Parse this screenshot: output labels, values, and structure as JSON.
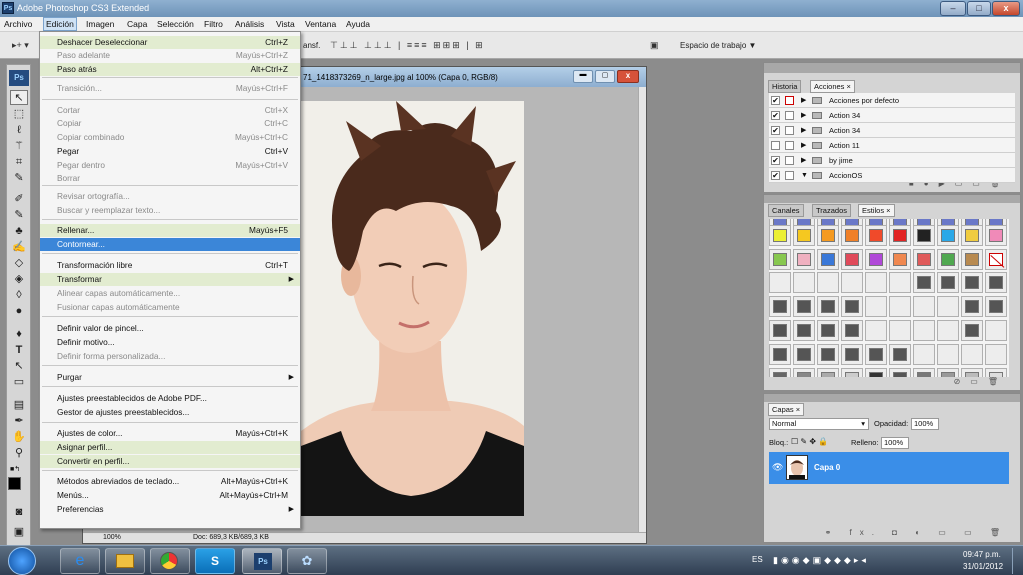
{
  "title_bar": {
    "app_icon": "Ps",
    "title": "Adobe Photoshop CS3 Extended",
    "minimize": "–",
    "maximize": "□",
    "close": "x"
  },
  "menubar": [
    "Archivo",
    "Edición",
    "Imagen",
    "Capa",
    "Selección",
    "Filtro",
    "Análisis",
    "Vista",
    "Ventana",
    "Ayuda"
  ],
  "options_bar": {
    "transform_label": "ansf.",
    "workspace_label": "Espacio de trabajo ▼"
  },
  "document": {
    "title": "71_1418373269_n_large.jpg al 100% (Capa 0, RGB/8)",
    "zoom": "100%",
    "doc_size": "Doc: 689,3 KB/689,3 KB"
  },
  "edit_menu": [
    {
      "label": "Deshacer Deseleccionar",
      "shortcut": "Ctrl+Z",
      "state": "hl"
    },
    {
      "label": "Paso adelante",
      "shortcut": "Mayús+Ctrl+Z",
      "state": "dis"
    },
    {
      "label": "Paso atrás",
      "shortcut": "Alt+Ctrl+Z",
      "state": "hl"
    },
    {
      "label": "Transición...",
      "shortcut": "Mayús+Ctrl+F",
      "state": "dis"
    },
    {
      "label": "Cortar",
      "shortcut": "Ctrl+X",
      "state": "dis"
    },
    {
      "label": "Copiar",
      "shortcut": "Ctrl+C",
      "state": "dis"
    },
    {
      "label": "Copiar combinado",
      "shortcut": "Mayús+Ctrl+C",
      "state": "dis"
    },
    {
      "label": "Pegar",
      "shortcut": "Ctrl+V",
      "state": "norm"
    },
    {
      "label": "Pegar dentro",
      "shortcut": "Mayús+Ctrl+V",
      "state": "dis"
    },
    {
      "label": "Borrar",
      "shortcut": "",
      "state": "dis"
    },
    {
      "label": "Revisar ortografía...",
      "shortcut": "",
      "state": "dis"
    },
    {
      "label": "Buscar y reemplazar texto...",
      "shortcut": "",
      "state": "dis"
    },
    {
      "label": "Rellenar...",
      "shortcut": "Mayús+F5",
      "state": "hl"
    },
    {
      "label": "Contornear...",
      "shortcut": "",
      "state": "act"
    },
    {
      "label": "Transformación libre",
      "shortcut": "Ctrl+T",
      "state": "norm"
    },
    {
      "label": "Transformar",
      "shortcut": "",
      "state": "hl",
      "sub": true
    },
    {
      "label": "Alinear capas automáticamente...",
      "shortcut": "",
      "state": "dis"
    },
    {
      "label": "Fusionar capas automáticamente",
      "shortcut": "",
      "state": "dis"
    },
    {
      "label": "Definir valor de pincel...",
      "shortcut": "",
      "state": "norm"
    },
    {
      "label": "Definir motivo...",
      "shortcut": "",
      "state": "norm"
    },
    {
      "label": "Definir forma personalizada...",
      "shortcut": "",
      "state": "dis"
    },
    {
      "label": "Purgar",
      "shortcut": "",
      "state": "norm",
      "sub": true
    },
    {
      "label": "Ajustes preestablecidos de Adobe PDF...",
      "shortcut": "",
      "state": "norm"
    },
    {
      "label": "Gestor de ajustes preestablecidos...",
      "shortcut": "",
      "state": "norm"
    },
    {
      "label": "Ajustes de color...",
      "shortcut": "Mayús+Ctrl+K",
      "state": "norm"
    },
    {
      "label": "Asignar perfil...",
      "shortcut": "",
      "state": "hl"
    },
    {
      "label": "Convertir en perfil...",
      "shortcut": "",
      "state": "hl"
    },
    {
      "label": "Métodos abreviados de teclado...",
      "shortcut": "Alt+Mayús+Ctrl+K",
      "state": "norm"
    },
    {
      "label": "Menús...",
      "shortcut": "Alt+Mayús+Ctrl+M",
      "state": "norm"
    },
    {
      "label": "Preferencias",
      "shortcut": "",
      "state": "norm",
      "sub": true
    }
  ],
  "history_panel": {
    "tabs": [
      "Historia",
      "Acciones ×"
    ],
    "actions": [
      "Acciones por defecto",
      "Action 34",
      "Action 34",
      "Action 11",
      "by jime",
      "AccionOS"
    ]
  },
  "styles_panel": {
    "tabs": [
      "Canales",
      "Trazados",
      "Estilos ×"
    ]
  },
  "layers_panel": {
    "tab": "Capas ×",
    "blend_mode": "Normal",
    "opacity_label": "Opacidad:",
    "opacity_value": "100%",
    "lock_label": "Bloq.:",
    "fill_label": "Relleno:",
    "fill_value": "100%",
    "layer_name": "Capa 0"
  },
  "taskbar": {
    "lang": "ES",
    "time": "09:47 p.m.",
    "date": "31/01/2012",
    "ps_label": "Ps"
  },
  "colors": {
    "menu_active": "#3b86d8",
    "menu_hl": "#e2ecd0",
    "layer_selected": "#3a8ee8"
  }
}
